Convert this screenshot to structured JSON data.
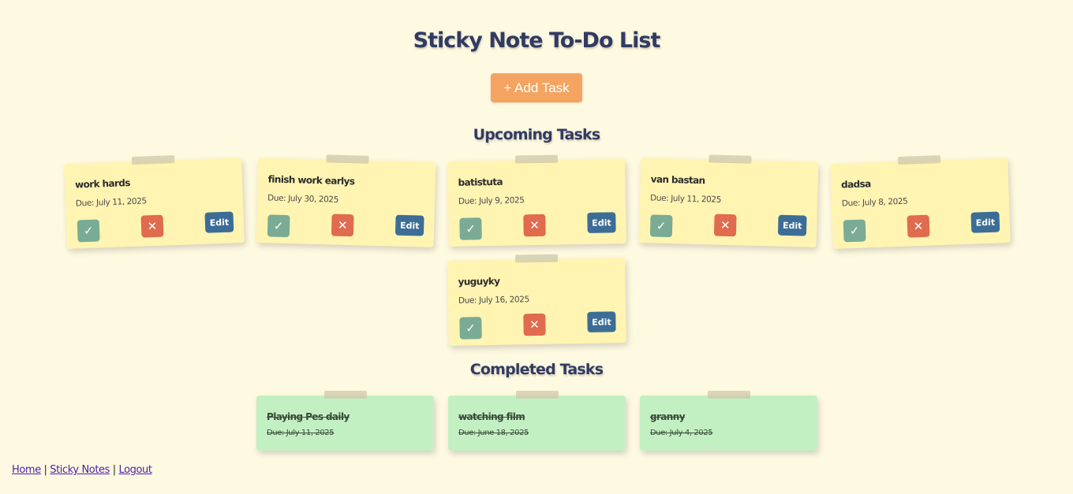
{
  "page": {
    "title": "Sticky Note To-Do List"
  },
  "actions": {
    "add_task_label": "+ Add Task"
  },
  "upcoming": {
    "heading": "Upcoming Tasks",
    "tasks": [
      {
        "title": "work hards",
        "due": "Due: July 11, 2025"
      },
      {
        "title": "finish work earlys",
        "due": "Due: July 30, 2025"
      },
      {
        "title": "batistuta",
        "due": "Due: July 9, 2025"
      },
      {
        "title": "van bastan",
        "due": "Due: July 11, 2025"
      },
      {
        "title": "dadsa",
        "due": "Due: July 8, 2025"
      },
      {
        "title": "yuguyky",
        "due": "Due: July 16, 2025"
      }
    ],
    "complete_symbol": "✓",
    "delete_symbol": "✕",
    "edit_label": "Edit"
  },
  "completed": {
    "heading": "Completed Tasks",
    "tasks": [
      {
        "title": "Playing Pes daily",
        "due": "Due: July 11, 2025"
      },
      {
        "title": "watching film",
        "due": "Due: June 18, 2025"
      },
      {
        "title": "granny",
        "due": "Due: July 4, 2025"
      }
    ]
  },
  "footer": {
    "links": [
      "Home",
      "Sticky Notes",
      "Logout"
    ],
    "separator": " | "
  },
  "colors": {
    "background": "#fef9e1",
    "note_yellow": "#fff4b2",
    "note_green": "#c3f0c3",
    "accent_orange": "#f4a460",
    "check_green": "#7aab94",
    "delete_red": "#e06b4e",
    "edit_blue": "#3c6d97"
  }
}
